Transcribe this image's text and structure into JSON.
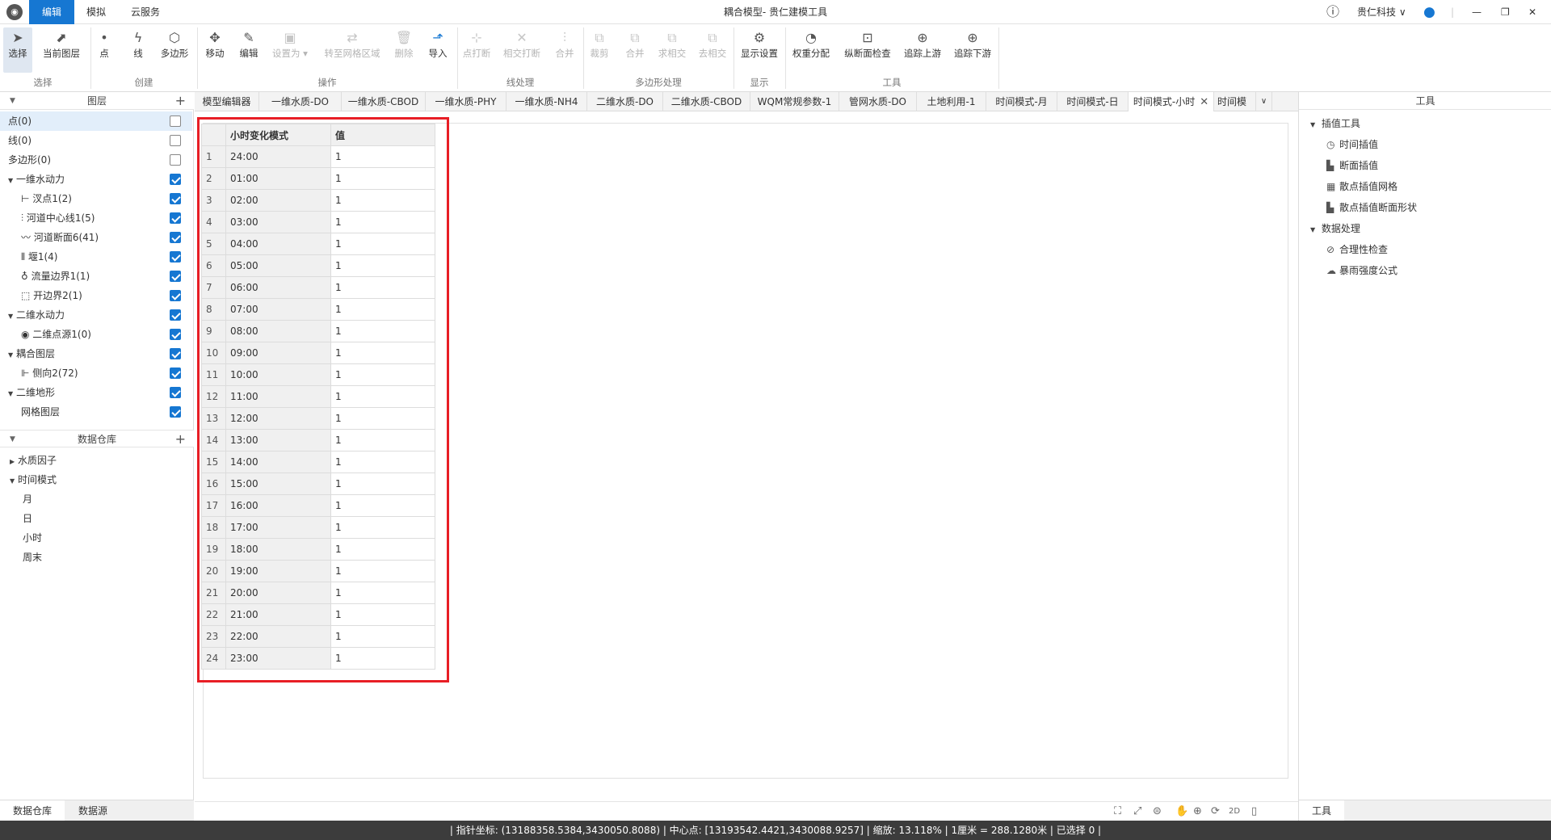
{
  "titlebar": {
    "menu_tabs": [
      "编辑",
      "模拟",
      "云服务"
    ],
    "title": "耦合模型- 贵仁建模工具",
    "company": "贵仁科技 ∨",
    "window_controls": {
      "minimize": "—",
      "restore": "❐",
      "close": "✕"
    }
  },
  "ribbon": {
    "buttons": [
      {
        "label": "选择",
        "icon": "cursor-icon"
      },
      {
        "label": "当前图层",
        "icon": "layer-cursor-icon"
      },
      {
        "label": "点",
        "icon": "point-icon"
      },
      {
        "label": "线",
        "icon": "line-icon"
      },
      {
        "label": "多边形",
        "icon": "polygon-icon"
      },
      {
        "label": "移动",
        "icon": "move-icon"
      },
      {
        "label": "编辑",
        "icon": "pencil-icon"
      },
      {
        "label": "设置为 ▾",
        "icon": "set-as-icon"
      },
      {
        "label": "转至网格区域",
        "icon": "transfer-icon"
      },
      {
        "label": "删除",
        "icon": "trash-icon"
      },
      {
        "label": "导入",
        "icon": "import-icon"
      },
      {
        "label": "点打断",
        "icon": "point-break-icon"
      },
      {
        "label": "相交打断",
        "icon": "intersect-break-icon"
      },
      {
        "label": "合并",
        "icon": "merge-icon"
      },
      {
        "label": "裁剪",
        "icon": "clip-icon"
      },
      {
        "label": "合并",
        "icon": "union-icon"
      },
      {
        "label": "求相交",
        "icon": "intersect-icon"
      },
      {
        "label": "去相交",
        "icon": "remove-intersect-icon"
      },
      {
        "label": "显示设置",
        "icon": "gear-icon"
      },
      {
        "label": "权重分配",
        "icon": "pie-icon"
      },
      {
        "label": "纵断面检查",
        "icon": "profile-check-icon"
      },
      {
        "label": "追踪上游",
        "icon": "trace-up-icon"
      },
      {
        "label": "追踪下游",
        "icon": "trace-down-icon"
      }
    ],
    "groups": [
      "选择",
      "创建",
      "操作",
      "线处理",
      "多边形处理",
      "显示",
      "工具"
    ]
  },
  "left_panel": {
    "layers_header": "图层",
    "layers": [
      {
        "label": "点(0)",
        "checked": false
      },
      {
        "label": "线(0)",
        "checked": false
      },
      {
        "label": "多边形(0)",
        "checked": false
      },
      {
        "label": "一维水动力",
        "checked": true
      },
      {
        "label": "汊点1(2)",
        "checked": true
      },
      {
        "label": "河道中心线1(5)",
        "checked": true
      },
      {
        "label": "河道断面6(41)",
        "checked": true
      },
      {
        "label": "堰1(4)",
        "checked": true
      },
      {
        "label": "流量边界1(1)",
        "checked": true
      },
      {
        "label": "开边界2(1)",
        "checked": true
      },
      {
        "label": "二维水动力",
        "checked": true
      },
      {
        "label": "二维点源1(0)",
        "checked": true
      },
      {
        "label": "耦合图层",
        "checked": true
      },
      {
        "label": "侧向2(72)",
        "checked": true
      },
      {
        "label": "二维地形",
        "checked": true
      },
      {
        "label": "网格图层",
        "checked": true
      }
    ],
    "warehouse_header": "数据仓库",
    "warehouse": [
      "水质因子",
      "时间模式",
      "月",
      "日",
      "小时",
      "周末"
    ],
    "bottom_tabs": [
      "数据仓库",
      "数据源"
    ]
  },
  "tabs": [
    "模型编辑器",
    "一维水质-DO",
    "一维水质-CBOD",
    "一维水质-PHY",
    "一维水质-NH4",
    "二维水质-DO",
    "二维水质-CBOD",
    "WQM常规参数-1",
    "管网水质-DO",
    "土地利用-1",
    "时间模式-月",
    "时间模式-日",
    "时间模式-小时",
    "时间模"
  ],
  "table": {
    "headers": [
      "小时变化模式",
      "值"
    ],
    "rows": [
      {
        "n": "1",
        "time": "24:00",
        "value": "1"
      },
      {
        "n": "2",
        "time": "01:00",
        "value": "1"
      },
      {
        "n": "3",
        "time": "02:00",
        "value": "1"
      },
      {
        "n": "4",
        "time": "03:00",
        "value": "1"
      },
      {
        "n": "5",
        "time": "04:00",
        "value": "1"
      },
      {
        "n": "6",
        "time": "05:00",
        "value": "1"
      },
      {
        "n": "7",
        "time": "06:00",
        "value": "1"
      },
      {
        "n": "8",
        "time": "07:00",
        "value": "1"
      },
      {
        "n": "9",
        "time": "08:00",
        "value": "1"
      },
      {
        "n": "10",
        "time": "09:00",
        "value": "1"
      },
      {
        "n": "11",
        "time": "10:00",
        "value": "1"
      },
      {
        "n": "12",
        "time": "11:00",
        "value": "1"
      },
      {
        "n": "13",
        "time": "12:00",
        "value": "1"
      },
      {
        "n": "14",
        "time": "13:00",
        "value": "1"
      },
      {
        "n": "15",
        "time": "14:00",
        "value": "1"
      },
      {
        "n": "16",
        "time": "15:00",
        "value": "1"
      },
      {
        "n": "17",
        "time": "16:00",
        "value": "1"
      },
      {
        "n": "18",
        "time": "17:00",
        "value": "1"
      },
      {
        "n": "19",
        "time": "18:00",
        "value": "1"
      },
      {
        "n": "20",
        "time": "19:00",
        "value": "1"
      },
      {
        "n": "21",
        "time": "20:00",
        "value": "1"
      },
      {
        "n": "22",
        "time": "21:00",
        "value": "1"
      },
      {
        "n": "23",
        "time": "22:00",
        "value": "1"
      },
      {
        "n": "24",
        "time": "23:00",
        "value": "1"
      }
    ]
  },
  "right_panel": {
    "header": "工具",
    "sections": [
      {
        "title": "插值工具",
        "items": [
          "时间插值",
          "断面插值",
          "散点插值网格",
          "散点插值断面形状"
        ]
      },
      {
        "title": "数据处理",
        "items": [
          "合理性检查",
          "暴雨强度公式"
        ]
      }
    ],
    "bottom_tab": "工具"
  },
  "map_tools": {
    "mode_label": "2D"
  },
  "statusbar": {
    "text": "|  指针坐标: (13188358.5384,3430050.8088)  |  中心点: [13193542.4421,3430088.9257]  |  缩放: 13.118%  |  1厘米 = 288.1280米  |  已选择 0  |"
  }
}
